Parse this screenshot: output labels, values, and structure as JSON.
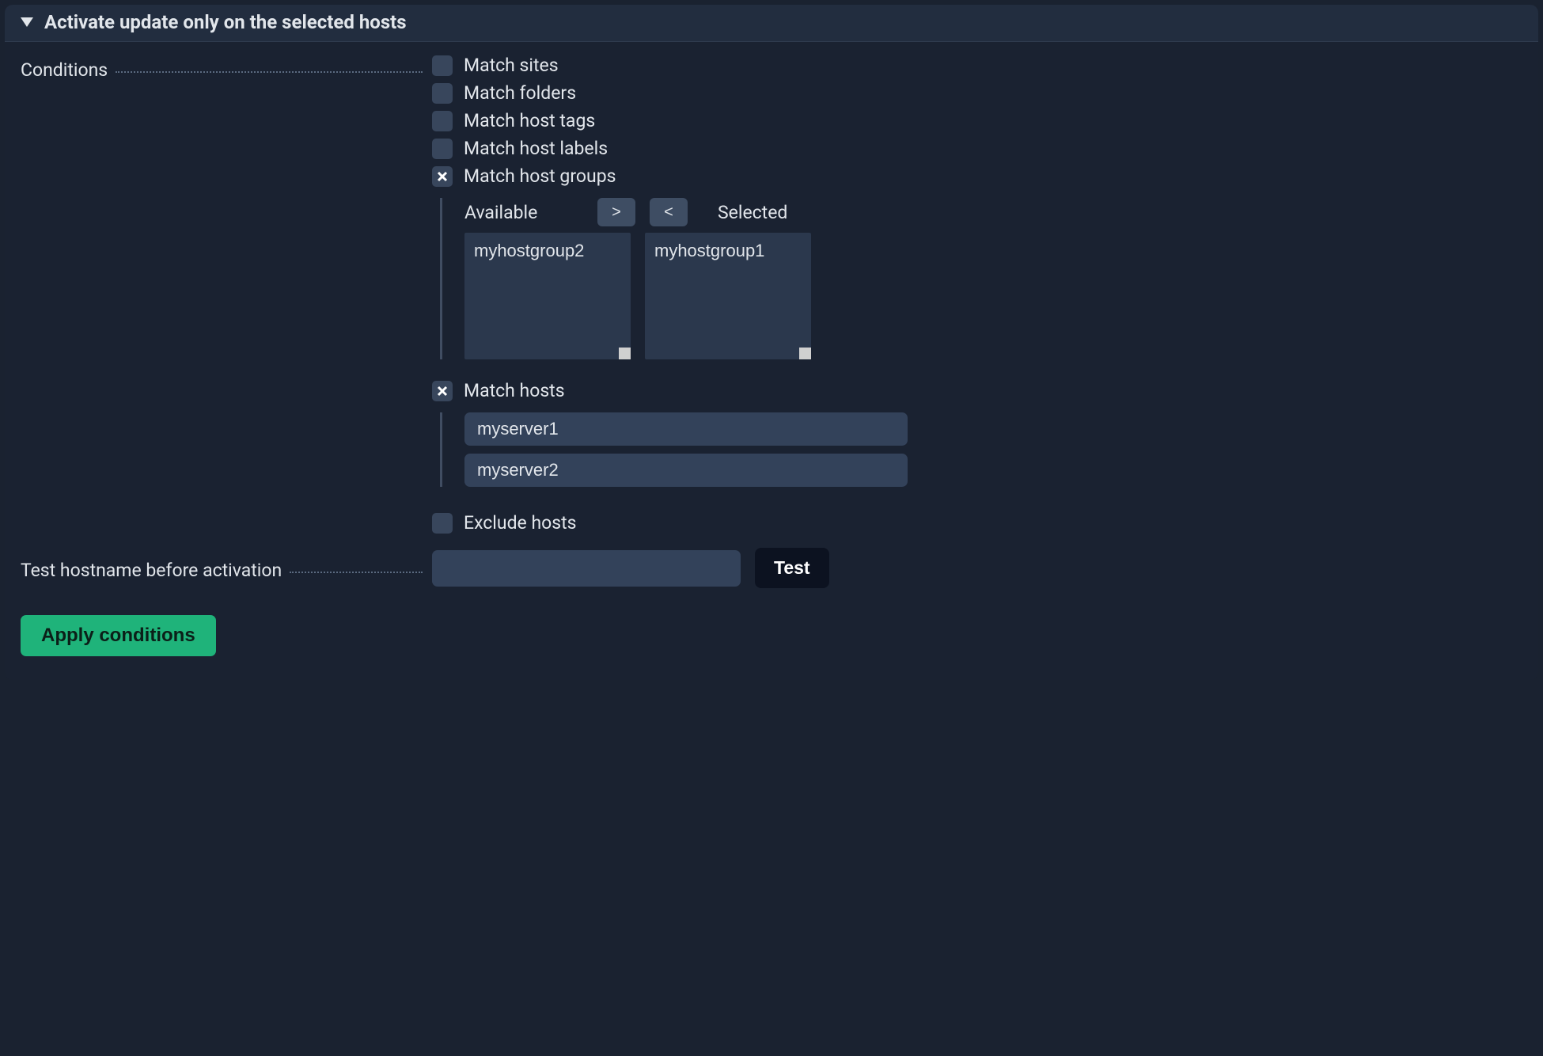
{
  "header": {
    "title": "Activate update only on the selected hosts"
  },
  "labels": {
    "conditions": "Conditions",
    "test_hostname": "Test hostname before activation"
  },
  "conditions": {
    "match_sites": {
      "label": "Match sites",
      "checked": false
    },
    "match_folders": {
      "label": "Match folders",
      "checked": false
    },
    "match_host_tags": {
      "label": "Match host tags",
      "checked": false
    },
    "match_host_labels": {
      "label": "Match host labels",
      "checked": false
    },
    "match_host_groups": {
      "label": "Match host groups",
      "checked": true
    },
    "match_hosts": {
      "label": "Match hosts",
      "checked": true
    },
    "exclude_hosts": {
      "label": "Exclude hosts",
      "checked": false
    }
  },
  "host_groups": {
    "available_header": "Available",
    "selected_header": "Selected",
    "move_right": ">",
    "move_left": "<",
    "available": [
      "myhostgroup2"
    ],
    "selected": [
      "myhostgroup1"
    ]
  },
  "match_hosts_values": [
    "myserver1",
    "myserver2"
  ],
  "test": {
    "value": "",
    "button": "Test"
  },
  "apply_button": "Apply conditions"
}
